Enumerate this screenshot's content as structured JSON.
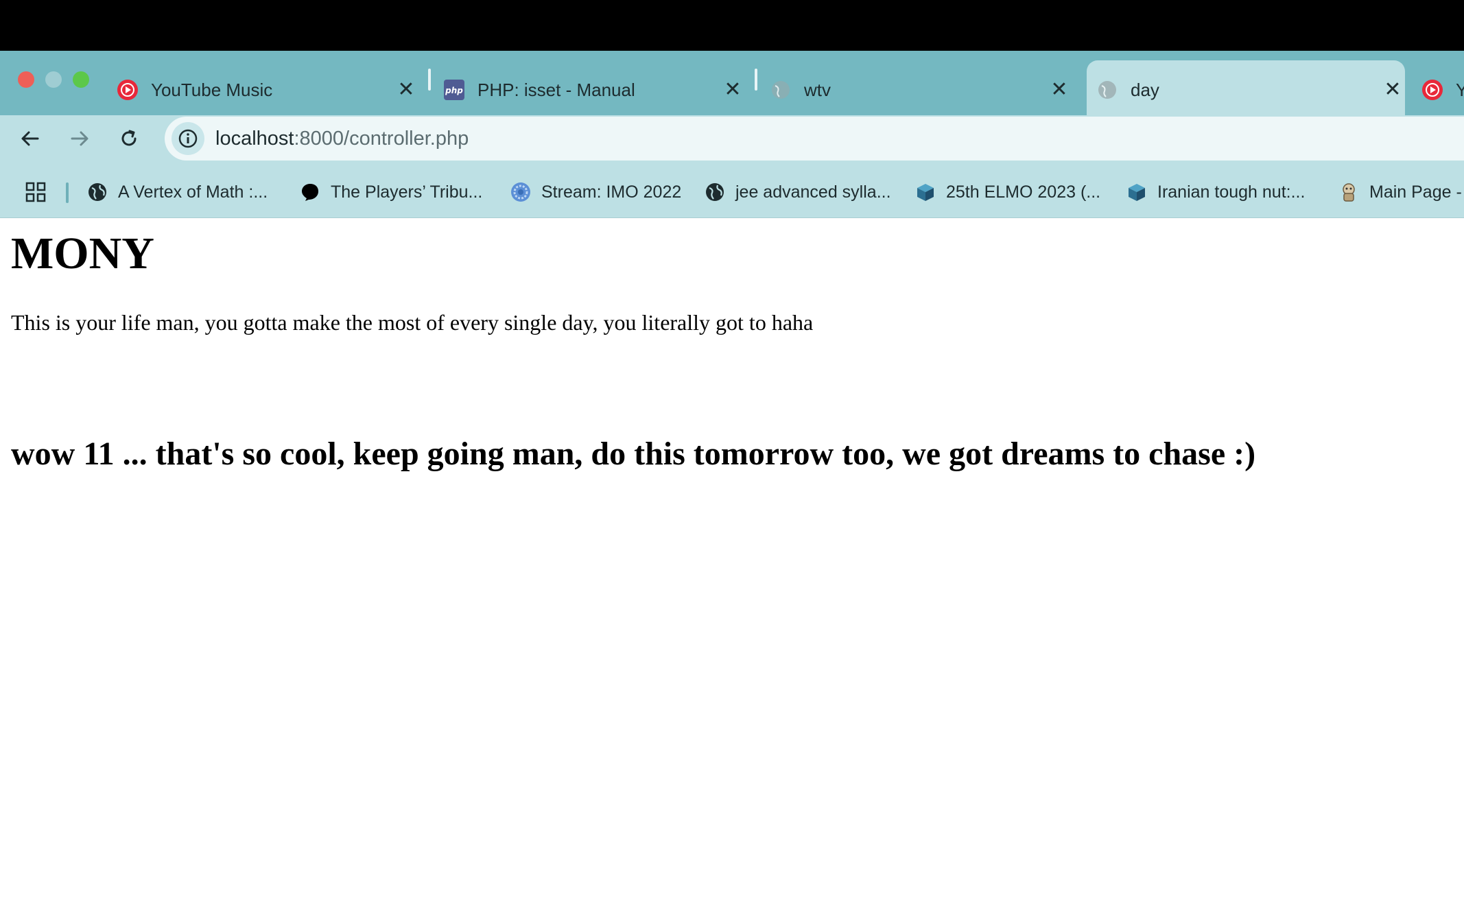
{
  "browser": {
    "tabs": [
      {
        "title": "YouTube Music",
        "icon": "youtube-music-icon",
        "active": false
      },
      {
        "title": "PHP: isset - Manual",
        "icon": "php-icon",
        "active": false
      },
      {
        "title": "wtv",
        "icon": "globe-icon",
        "active": false
      },
      {
        "title": "day",
        "icon": "globe-icon",
        "active": true
      },
      {
        "title": "Y",
        "icon": "youtube-music-icon",
        "active": false
      }
    ],
    "close_glyph": "✕",
    "address": {
      "host": "localhost",
      "path": ":8000/controller.php"
    },
    "bookmarks": [
      {
        "label": "A Vertex of Math :...",
        "icon": "globe-icon"
      },
      {
        "label": "The Players’ Tribu...",
        "icon": "players-tribune-icon"
      },
      {
        "label": "Stream: IMO 2022",
        "icon": "zulip-icon"
      },
      {
        "label": "jee advanced sylla...",
        "icon": "globe-icon"
      },
      {
        "label": "25th ELMO 2023 (...",
        "icon": "cube-icon"
      },
      {
        "label": "Iranian tough nut:...",
        "icon": "cube-icon"
      },
      {
        "label": "Main Page -",
        "icon": "wiki-icon"
      }
    ],
    "colors": {
      "tabstrip": "#74b8c1",
      "active_tab": "#bde0e4",
      "toolbar": "#bde0e4"
    }
  },
  "page": {
    "heading": "MONY",
    "paragraph": "This is your life man, you gotta make the most of every single day, you literally got to haha",
    "subheading": "wow 11 ... that's so cool, keep going man, do this tomorrow too, we got dreams to chase :)"
  }
}
